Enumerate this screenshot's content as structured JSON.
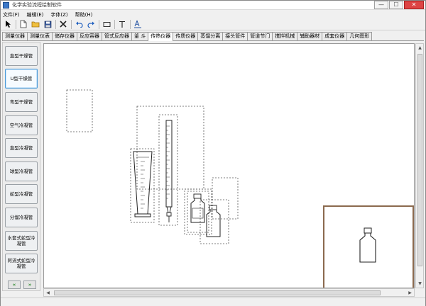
{
  "window": {
    "title": "化学实验流程绘制软件",
    "controls": {
      "minimize": "—",
      "maximize": "☐",
      "close": "✕"
    }
  },
  "menu": [
    {
      "label": "文件(F)"
    },
    {
      "label": "编辑(E)"
    },
    {
      "label": "字体(Z)"
    },
    {
      "label": "帮助(H)"
    }
  ],
  "toolbar": {
    "buttons": [
      {
        "name": "pointer",
        "glyph": "↖"
      },
      {
        "name": "new",
        "glyph": "🗋"
      },
      {
        "name": "open",
        "glyph": "📂"
      },
      {
        "name": "save",
        "glyph": "💾"
      },
      {
        "name": "delete",
        "glyph": "✕"
      },
      {
        "name": "undo",
        "glyph": "↶"
      },
      {
        "name": "redo",
        "glyph": "↷"
      },
      {
        "name": "rectangle",
        "glyph": "▭"
      },
      {
        "name": "text",
        "glyph": "T"
      },
      {
        "name": "font",
        "glyph": "A"
      }
    ]
  },
  "tabs": [
    {
      "label": "测量仪器",
      "active": false
    },
    {
      "label": "测量仪表",
      "active": false
    },
    {
      "label": "储存仪器",
      "active": false
    },
    {
      "label": "反应容器",
      "active": false
    },
    {
      "label": "管式反应器",
      "active": false
    },
    {
      "label": "釜 斗",
      "active": false
    },
    {
      "label": "传热仪器",
      "active": true
    },
    {
      "label": "传质仪器",
      "active": false
    },
    {
      "label": "蒸馏分离",
      "active": false
    },
    {
      "label": "接头管件",
      "active": false
    },
    {
      "label": "管道节门",
      "active": false
    },
    {
      "label": "搅拌机械",
      "active": false
    },
    {
      "label": "辅助器材",
      "active": false
    },
    {
      "label": "成套仪器",
      "active": false
    },
    {
      "label": "几何图形",
      "active": false
    }
  ],
  "sidebar": {
    "items": [
      {
        "label": "直型干燥管",
        "selected": false
      },
      {
        "label": "U型干燥管",
        "selected": true
      },
      {
        "label": "弯型干燥管",
        "selected": false
      },
      {
        "label": "空气冷凝管",
        "selected": false
      },
      {
        "label": "直型冷凝管",
        "selected": false
      },
      {
        "label": "球型冷凝管",
        "selected": false
      },
      {
        "label": "蛇型冷凝管",
        "selected": false
      },
      {
        "label": "分馏冷凝管",
        "selected": false
      },
      {
        "label": "水套式蛇型冷凝管",
        "selected": false
      },
      {
        "label": "阿流式蛇型冷凝管",
        "selected": false
      }
    ],
    "nav": {
      "prev": "«",
      "next": "»"
    }
  },
  "scrollbars": {
    "up": "▲",
    "down": "▼",
    "left": "◀",
    "right": "▶"
  }
}
